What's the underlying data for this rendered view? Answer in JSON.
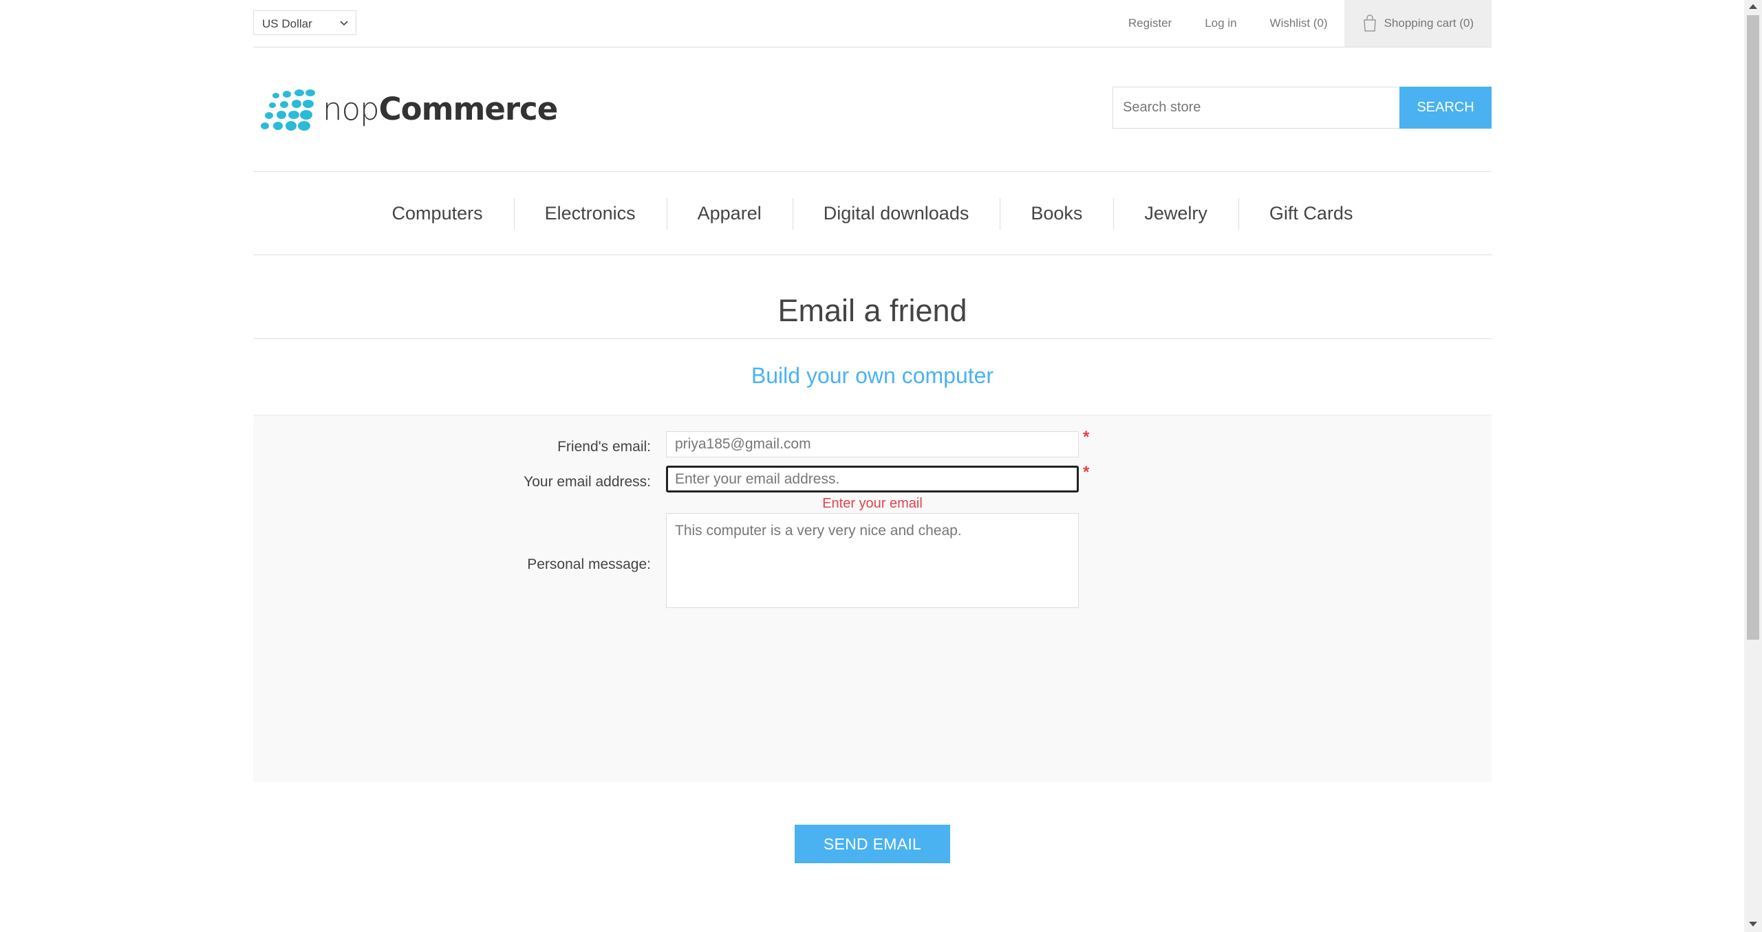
{
  "header": {
    "currency": "US Dollar",
    "links": {
      "register": "Register",
      "login": "Log in",
      "wishlist": "Wishlist (0)",
      "cart": "Shopping cart (0)"
    }
  },
  "logo": {
    "part1": "nop",
    "part2": "Commerce"
  },
  "search": {
    "placeholder": "Search store",
    "button": "SEARCH"
  },
  "menu": [
    "Computers",
    "Electronics",
    "Apparel",
    "Digital downloads",
    "Books",
    "Jewelry",
    "Gift Cards"
  ],
  "page": {
    "title": "Email a friend",
    "product": "Build your own computer"
  },
  "form": {
    "friend_email_label": "Friend's email:",
    "friend_email_value": "priya185@gmail.com",
    "your_email_label": "Your email address:",
    "your_email_placeholder": "Enter your email address.",
    "your_email_error": "Enter your email",
    "message_label": "Personal message:",
    "message_value": "This computer is a very very nice and cheap.",
    "required_mark": "*",
    "send_button": "SEND EMAIL"
  },
  "colors": {
    "accent": "#4ab2f1",
    "error": "#e4434b",
    "logo_dots": "#2bbbd8"
  }
}
